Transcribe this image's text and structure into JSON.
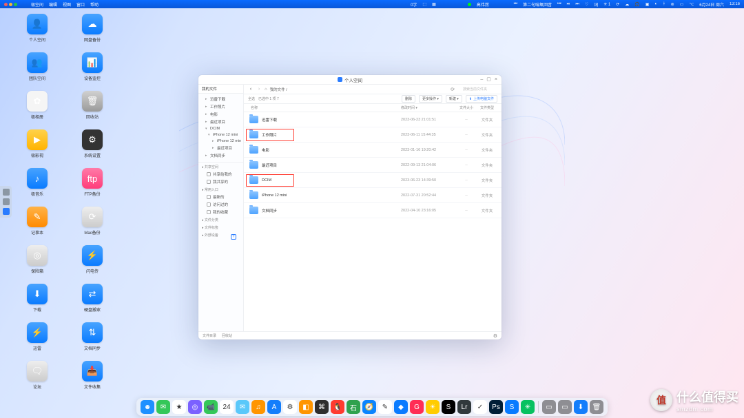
{
  "menubar": {
    "app": "极空间",
    "menus": [
      "编辑",
      "视图",
      "窗口",
      "帮助"
    ],
    "center1": "0字",
    "user": "高伟然",
    "song": "第二句喘氧回音",
    "date": "6月24日 周六",
    "time": "13:16"
  },
  "desktop": {
    "col1": [
      {
        "label": "个人空间",
        "ic": "ic-blue",
        "glyph": "👤"
      },
      {
        "label": "团队空间",
        "ic": "ic-blue",
        "glyph": "👥"
      },
      {
        "label": "极相册",
        "ic": "ic-white",
        "glyph": "✿"
      },
      {
        "label": "极影视",
        "ic": "ic-yellow",
        "glyph": "▶"
      },
      {
        "label": "极音乐",
        "ic": "ic-blue",
        "glyph": "♪"
      },
      {
        "label": "记事本",
        "ic": "ic-orange",
        "glyph": "✎"
      },
      {
        "label": "保险箱",
        "ic": "ic-gray2",
        "glyph": "◎"
      },
      {
        "label": "下载",
        "ic": "ic-blue",
        "glyph": "⬇"
      },
      {
        "label": "迅雷",
        "ic": "ic-blue",
        "glyph": "⚡"
      },
      {
        "label": "论坛",
        "ic": "ic-gray2",
        "glyph": "🗨"
      }
    ],
    "col2": [
      {
        "label": "网盘备份",
        "ic": "ic-blue",
        "glyph": "☁"
      },
      {
        "label": "设备监控",
        "ic": "ic-blue",
        "glyph": "📊"
      },
      {
        "label": "回收站",
        "ic": "ic-gray",
        "glyph": "🗑"
      },
      {
        "label": "系统设置",
        "ic": "ic-dark",
        "glyph": "⚙"
      },
      {
        "label": "FTP备份",
        "ic": "ic-pink",
        "glyph": "ftp"
      },
      {
        "label": "Mac备份",
        "ic": "ic-gray2",
        "glyph": "⟳"
      },
      {
        "label": "闪电传",
        "ic": "ic-blue",
        "glyph": "⚡"
      },
      {
        "label": "硬盘搬家",
        "ic": "ic-blue",
        "glyph": "⇄"
      },
      {
        "label": "文档同步",
        "ic": "ic-blue",
        "glyph": "⇅"
      },
      {
        "label": "文件收集",
        "ic": "ic-blue",
        "glyph": "📥"
      }
    ]
  },
  "window": {
    "title": "个人空间",
    "controls": {
      "min": "–",
      "max": "▢",
      "close": "×"
    },
    "sidebar": {
      "tab": "我的文件",
      "tree": [
        {
          "label": "迅雷下载",
          "lvl": 0
        },
        {
          "label": "工作照片",
          "lvl": 0
        },
        {
          "label": "电影",
          "lvl": 0
        },
        {
          "label": "最近项目",
          "lvl": 0
        },
        {
          "label": "DCIM",
          "lvl": 0,
          "open": true
        },
        {
          "label": "iPhone 12 mini",
          "lvl": 1,
          "open": true
        },
        {
          "label": "iPhone 12 min",
          "lvl": 2
        },
        {
          "label": "最近项目",
          "lvl": 2
        },
        {
          "label": "文档同步",
          "lvl": 0
        }
      ],
      "sections": [
        {
          "title": "共享空间",
          "items": [
            "共享给我的",
            "我共享的"
          ]
        },
        {
          "title": "常用入口",
          "items": [
            "最新的",
            "访问过的",
            "我的收藏"
          ]
        },
        {
          "title": "文件分类",
          "items": []
        },
        {
          "title": "文件标签",
          "items": []
        },
        {
          "title": "外部设备",
          "items": [],
          "plus": true
        }
      ]
    },
    "breadcrumb": {
      "back": "‹",
      "fwd": "›",
      "home": "⌂",
      "path": "我的文件 /",
      "refresh": "⟳",
      "search_ph": "搜索当前文件夹"
    },
    "toolbar": {
      "select": "全选",
      "count": "已选中 1 项 7",
      "b_delete": "删除",
      "b_more": "更多操作 ▾",
      "b_new": "新建 ▾",
      "b_upload": "上传电脑文件"
    },
    "columns": {
      "name": "名称",
      "date": "修改时间 ▾",
      "size": "文件大小",
      "type": "文件类型"
    },
    "rows": [
      {
        "name": "迅雷下载",
        "date": "2023-06-23 21:01:51",
        "size": "--",
        "type": "文件夹",
        "hl": false
      },
      {
        "name": "工作照片",
        "date": "2023-06-11 15:44:35",
        "size": "--",
        "type": "文件夹",
        "hl": true
      },
      {
        "name": "电影",
        "date": "2023-01-16 19:20:42",
        "size": "--",
        "type": "文件夹",
        "hl": false
      },
      {
        "name": "最近项目",
        "date": "2022-09-13 21:04:06",
        "size": "--",
        "type": "文件夹",
        "hl": false
      },
      {
        "name": "DCIM",
        "date": "2023-06-23 14:39:50",
        "size": "--",
        "type": "文件夹",
        "hl": true
      },
      {
        "name": "iPhone 12 mini",
        "date": "2022-07-31 20:52:44",
        "size": "--",
        "type": "文件夹",
        "hl": false
      },
      {
        "name": "文档同步",
        "date": "2022-04-10 23:16:05",
        "size": "--",
        "type": "文件夹",
        "hl": false
      }
    ],
    "footer": {
      "left1": "文件目录",
      "left2": "回收站",
      "gear": "⚙"
    }
  },
  "dock": [
    {
      "c": "#1e90ff",
      "g": "☻"
    },
    {
      "c": "#34c759",
      "g": "✉"
    },
    {
      "c": "#ffffff",
      "g": "★"
    },
    {
      "c": "#7b61ff",
      "g": "◎"
    },
    {
      "c": "#34c759",
      "g": "📹"
    },
    {
      "c": "#ffffff",
      "g": "24"
    },
    {
      "c": "#5ac8fa",
      "g": "✉"
    },
    {
      "c": "#ff9500",
      "g": "♫"
    },
    {
      "c": "#147efb",
      "g": "A"
    },
    {
      "c": "#ffffff",
      "g": "⚙"
    },
    {
      "c": "#ff9500",
      "g": "◧"
    },
    {
      "c": "#2e2e2e",
      "g": "⌘"
    },
    {
      "c": "#ff3b30",
      "g": "🐧"
    },
    {
      "c": "#30a14e",
      "g": "石"
    },
    {
      "c": "#0a84ff",
      "g": "🧭"
    },
    {
      "c": "#ffffff",
      "g": "✎"
    },
    {
      "c": "#0a7bff",
      "g": "◆"
    },
    {
      "c": "#ff2d55",
      "g": "G"
    },
    {
      "c": "#ffcc00",
      "g": "☀"
    },
    {
      "c": "#000000",
      "g": "S"
    },
    {
      "c": "#31393c",
      "g": "Lr"
    },
    {
      "c": "#ffffff",
      "g": "✓"
    },
    {
      "c": "#001e36",
      "g": "Ps"
    },
    {
      "c": "#0a7bff",
      "g": "S"
    },
    {
      "c": "#07c160",
      "g": "✳"
    },
    {
      "c": "#8e8e93",
      "g": "▭"
    },
    {
      "c": "#8e8e93",
      "g": "▭"
    },
    {
      "c": "#147efb",
      "g": "⬇"
    },
    {
      "c": "#8e8e93",
      "g": "🗑"
    }
  ],
  "watermark": {
    "brand": "值",
    "text": "什么值得买",
    "sub": "smzdm.com"
  }
}
